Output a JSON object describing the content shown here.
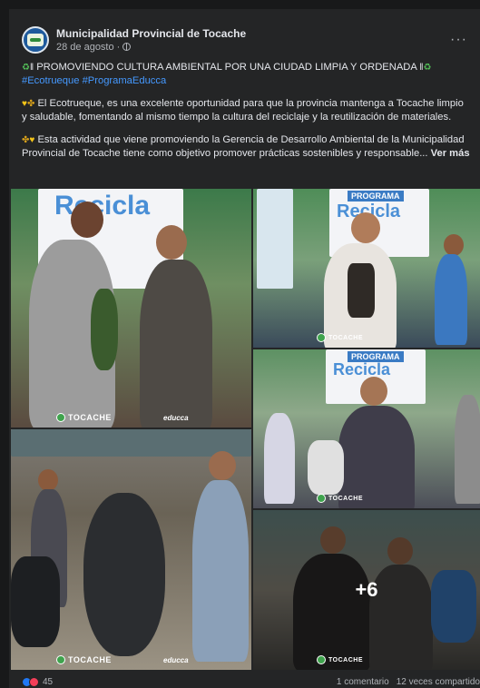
{
  "post": {
    "page_name": "Municipalidad Provincial de Tocache",
    "date": "28 de agosto",
    "separator": "·",
    "more": "···",
    "title_line": "PROMOVIENDO CULTURA AMBIENTAL POR UNA CIUDAD LIMPIA Y ORDENADA",
    "hashtags": [
      "#Ecotrueque",
      "#ProgramaEducca"
    ],
    "paragraph1": "El Ecotrueque, es una excelente oportunidad para que la provincia mantenga a Tocache limpio y saludable, fomentando al mismo tiempo la cultura del reciclaje y la reutilización de materiales.",
    "paragraph2": "Esta actividad que viene promoviendo la Gerencia de Desarrollo Ambiental de la Municipalidad Provincial de Tocache tiene como objetivo promover prácticas sostenibles y responsable...",
    "see_more": "Ver más"
  },
  "gallery": {
    "banner_word": "Recicla",
    "program_label": "PROGRAMA",
    "watermark": "TOCACHE",
    "watermark_right": "educca",
    "more_count": "+6"
  },
  "footer": {
    "reactions_count": "45",
    "comments": "1 comentario",
    "shares": "12 veces compartido"
  },
  "icons": {
    "avatar": "municipality-logo",
    "globe": "globe-icon",
    "recycle": "recycle-icon",
    "like": "like-icon",
    "love": "love-icon"
  },
  "colors": {
    "background": "#18191a",
    "card": "#242526",
    "hashtag": "#4599ff",
    "text": "#e4e6eb",
    "muted": "#b0b3b8"
  }
}
